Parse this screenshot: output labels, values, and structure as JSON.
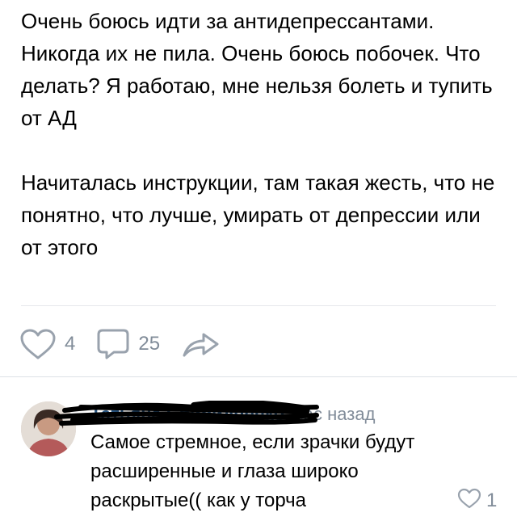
{
  "post": {
    "paragraph1": "Очень боюсь идти за антидепрессантами. Никогда их не пила. Очень боюсь побочек. Что делать? Я работаю, мне нельзя болеть и тупить от АД",
    "paragraph2": "Начиталась инструкции, там такая жесть, что не понятно, что лучше, умирать от депрессии или от этого"
  },
  "actions": {
    "likes": "4",
    "comments": "25",
    "like_icon": "heart-outline-icon",
    "comment_icon": "comment-bubble-icon",
    "share_icon": "share-arrow-icon"
  },
  "comment": {
    "author": "Татьяна Свиридченко",
    "time": "час назад",
    "text": "Самое стремное, если зрачки будут расширенные и глаза широко раскрытые(( как у торча",
    "likes": "1"
  },
  "colors": {
    "text": "#000000",
    "muted": "#818c99",
    "icon": "#99a2ad",
    "link": "#2a5885",
    "divider": "#e6e7eb"
  }
}
